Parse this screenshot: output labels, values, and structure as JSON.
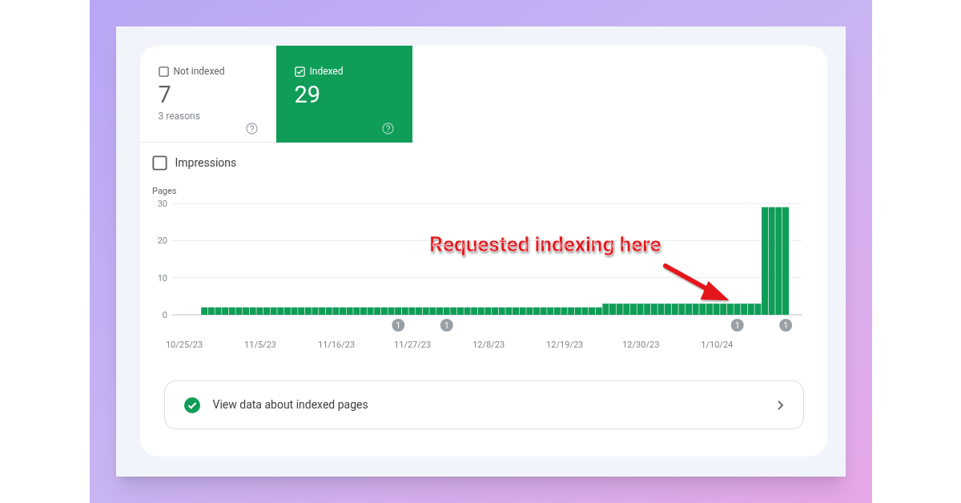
{
  "tiles": [
    {
      "label": "Not indexed",
      "value": "7",
      "subtitle": "3 reasons",
      "selected": false
    },
    {
      "label": "Indexed",
      "value": "29",
      "selected": true
    }
  ],
  "impressions": {
    "label": "Impressions",
    "checked": false
  },
  "chart": {
    "chart_data": {
      "type": "bar",
      "ylabel": "Pages",
      "ylim": [
        0,
        30
      ],
      "yticks": [
        0,
        10,
        20,
        30
      ],
      "categories": [
        "10/25/23",
        null,
        null,
        null,
        null,
        null,
        null,
        null,
        null,
        null,
        null,
        "11/5/23",
        null,
        null,
        null,
        null,
        null,
        null,
        null,
        null,
        null,
        null,
        "11/16/23",
        null,
        null,
        null,
        null,
        null,
        null,
        null,
        null,
        null,
        null,
        "11/27/23",
        null,
        null,
        null,
        null,
        null,
        null,
        null,
        null,
        null,
        null,
        "12/8/23",
        null,
        null,
        null,
        null,
        null,
        null,
        null,
        null,
        null,
        null,
        "12/19/23",
        null,
        null,
        null,
        null,
        null,
        null,
        null,
        null,
        null,
        null,
        "12/30/23",
        null,
        null,
        null,
        null,
        null,
        null,
        null,
        null,
        null,
        null,
        "1/10/24",
        null,
        null,
        null,
        null,
        null,
        null,
        null,
        null,
        null,
        null
      ],
      "series": [
        {
          "color": "#0f9d58",
          "values": [
            null,
            null,
            null,
            2,
            2,
            2,
            2,
            2,
            2,
            2,
            2,
            2,
            2,
            2,
            2,
            2,
            2,
            2,
            2,
            2,
            2,
            2,
            2,
            2,
            2,
            2,
            2,
            2,
            2,
            2,
            2,
            2,
            2,
            2,
            2,
            2,
            2,
            2,
            2,
            2,
            2,
            2,
            2,
            2,
            2,
            2,
            2,
            2,
            2,
            2,
            2,
            2,
            2,
            2,
            2,
            2,
            2,
            2,
            2,
            2,
            2,
            3,
            3,
            3,
            3,
            3,
            3,
            3,
            3,
            3,
            3,
            3,
            3,
            3,
            3,
            3,
            3,
            3,
            3,
            3,
            3,
            3,
            3,
            3,
            29,
            29,
            29,
            29
          ]
        }
      ]
    },
    "markers": [
      {
        "label": "1"
      },
      {
        "label": "1"
      },
      {
        "label": "1"
      },
      {
        "label": "1"
      }
    ],
    "callout": {
      "text": "Requested indexing here"
    }
  },
  "link": {
    "label": "View data about indexed pages"
  }
}
